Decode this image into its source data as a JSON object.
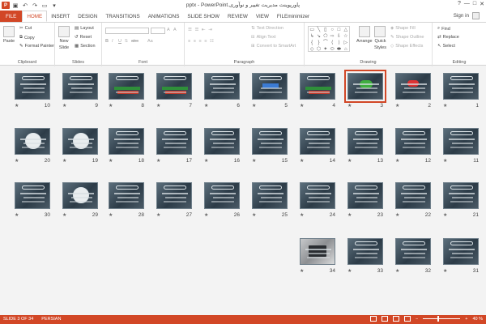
{
  "window": {
    "title": "پاورپوینت مدیریت تغییر و نوآوری.pptx - PowerPoint",
    "controls": [
      "?",
      "—",
      "□",
      "✕"
    ]
  },
  "qat": {
    "app_icon": "P",
    "save_icon": "save-icon",
    "undo_icon": "undo-icon",
    "redo_icon": "redo-icon",
    "start_icon": "start-from-beginning-icon",
    "customize_icon": "customize-qat-icon"
  },
  "tabs": [
    "FILE",
    "HOME",
    "INSERT",
    "DESIGN",
    "TRANSITIONS",
    "ANIMATIONS",
    "SLIDE SHOW",
    "REVIEW",
    "VIEW",
    "FILEminimizer"
  ],
  "active_tab": "HOME",
  "signin": "Sign in",
  "ribbon": {
    "clipboard": {
      "label": "Clipboard",
      "paste": "Paste",
      "cut": "Cut",
      "copy": "Copy",
      "format_painter": "Format Painter"
    },
    "slides": {
      "label": "Slides",
      "new_slide": "New",
      "new_slide2": "Slide",
      "layout": "Layout",
      "reset": "Reset",
      "section": "Section"
    },
    "font": {
      "label": "Font",
      "bold": "B",
      "italic": "I",
      "underline": "U",
      "strike": "S",
      "abc": "abc",
      "aa": "Aa",
      "grow": "A",
      "shrink": "A"
    },
    "paragraph": {
      "label": "Paragraph",
      "text_direction": "Text Direction",
      "align_text": "Align Text",
      "smartart": "Convert to SmartArt"
    },
    "drawing": {
      "label": "Drawing",
      "arrange": "Arrange",
      "quick": "Quick",
      "styles": "Styles",
      "shape_fill": "Shape Fill",
      "shape_outline": "Shape Outline",
      "shape_effects": "Shape Effects"
    },
    "editing": {
      "label": "Editing",
      "find": "Find",
      "replace": "Replace",
      "select": "Select"
    }
  },
  "shape_gallery_glyphs": [
    "▭",
    "╲",
    "▯",
    "○",
    "□",
    "△",
    "↳",
    "↘",
    "⬠",
    "⇨",
    "⇩",
    "☆",
    "{",
    "}",
    "⌒",
    "⟨",
    "⟩",
    "▷",
    "◇",
    "⬡",
    "✦",
    "⬭",
    "⬬",
    "⌂"
  ],
  "slides": [
    {
      "n": "1",
      "v": ""
    },
    {
      "n": "2",
      "v": "red"
    },
    {
      "n": "3",
      "v": "green",
      "selected": true
    },
    {
      "n": "4",
      "v": "table"
    },
    {
      "n": "5",
      "v": "blue"
    },
    {
      "n": "6",
      "v": ""
    },
    {
      "n": "7",
      "v": "table"
    },
    {
      "n": "8",
      "v": "table"
    },
    {
      "n": "9",
      "v": ""
    },
    {
      "n": "10",
      "v": ""
    },
    {
      "n": "11",
      "v": ""
    },
    {
      "n": "12",
      "v": ""
    },
    {
      "n": "13",
      "v": ""
    },
    {
      "n": "14",
      "v": ""
    },
    {
      "n": "15",
      "v": ""
    },
    {
      "n": "16",
      "v": ""
    },
    {
      "n": "17",
      "v": ""
    },
    {
      "n": "18",
      "v": ""
    },
    {
      "n": "19",
      "v": "circle"
    },
    {
      "n": "20",
      "v": "circle"
    },
    {
      "n": "21",
      "v": ""
    },
    {
      "n": "22",
      "v": ""
    },
    {
      "n": "23",
      "v": ""
    },
    {
      "n": "24",
      "v": ""
    },
    {
      "n": "25",
      "v": ""
    },
    {
      "n": "26",
      "v": ""
    },
    {
      "n": "27",
      "v": ""
    },
    {
      "n": "28",
      "v": ""
    },
    {
      "n": "29",
      "v": "circle"
    },
    {
      "n": "30",
      "v": ""
    },
    {
      "n": "31",
      "v": ""
    },
    {
      "n": "32",
      "v": ""
    },
    {
      "n": "33",
      "v": ""
    },
    {
      "n": "34",
      "v": "photo"
    }
  ],
  "star_glyph": "★",
  "status": {
    "slide_of": "SLIDE 3 OF 34",
    "language": "PERSIAN",
    "zoom": "40 %",
    "zoom_minus": "−",
    "zoom_plus": "+",
    "zoom_fraction": 0.4
  }
}
